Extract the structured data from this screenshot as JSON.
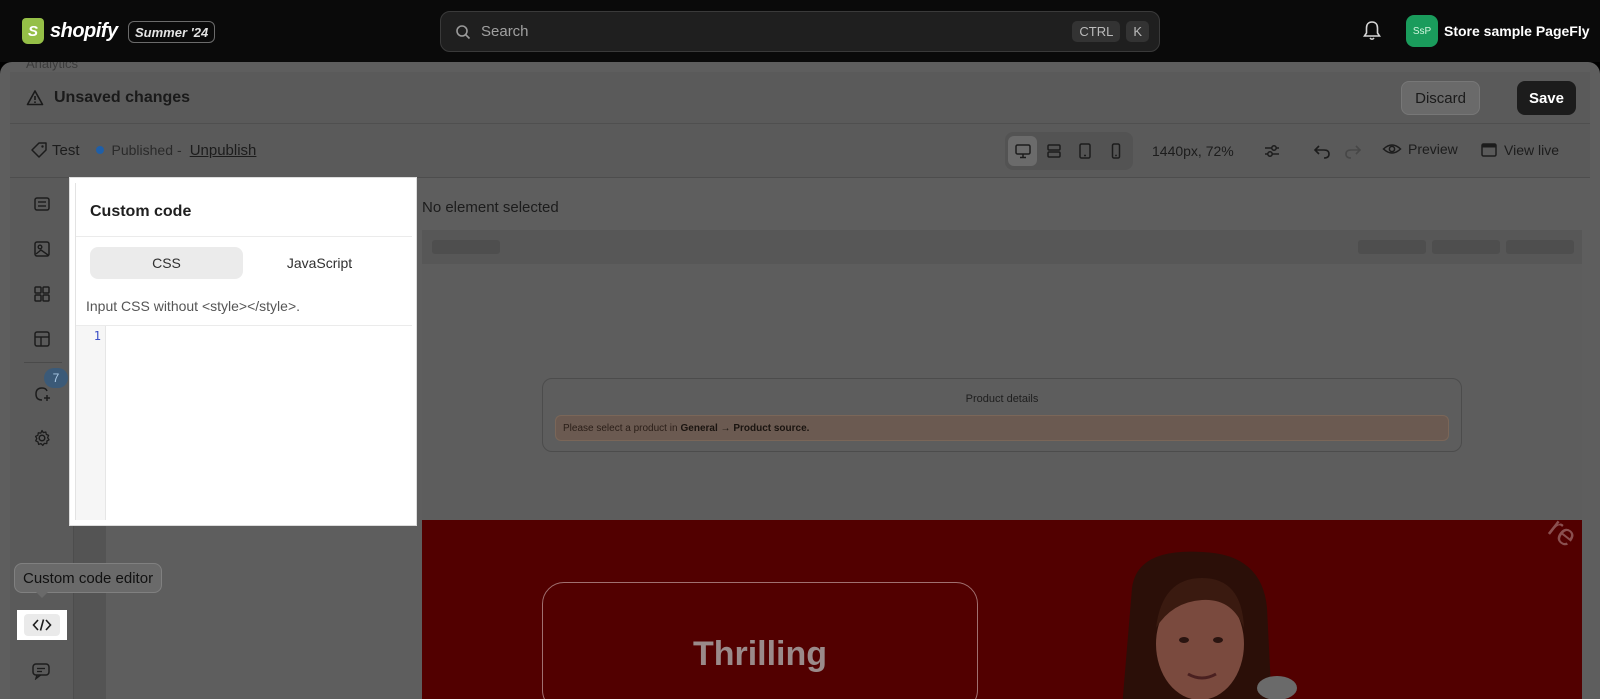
{
  "topbar": {
    "brand": "shopify",
    "brand_initial": "S",
    "edition": "Summer '24",
    "search_placeholder": "Search",
    "shortcut_key1": "CTRL",
    "shortcut_key2": "K",
    "store_initials": "SsP",
    "store_name": "Store sample PageFly"
  },
  "analytics_label": "Analytics",
  "unsaved": {
    "title": "Unsaved changes",
    "discard_label": "Discard",
    "save_label": "Save"
  },
  "toolbar": {
    "page_name": "Test",
    "status": "Published",
    "separator": "-",
    "unpublish_label": "Unpublish",
    "viewport": "1440px, 72%",
    "preview_label": "Preview",
    "view_live_label": "View live"
  },
  "rail": {
    "badge_count": "7"
  },
  "canvas": {
    "no_selection": "No element selected",
    "product_title": "Product details",
    "warning_prefix": "Please select a product in",
    "warning_path": "General → Product source.",
    "hero_title": "Thrilling",
    "hero_corner_text": "re"
  },
  "custom_code": {
    "title": "Custom code",
    "tabs": [
      "CSS",
      "JavaScript"
    ],
    "active_tab": "CSS",
    "hint": "Input CSS without <style></style>.",
    "line_number": "1"
  },
  "tooltip": "Custom code editor",
  "colors": {
    "topbar_bg": "#0a0a0a",
    "shopify_green": "#95bf47",
    "avatar_green": "#1a9c5c",
    "hero_red": "#520000",
    "published_dot": "#1f5fa8"
  }
}
